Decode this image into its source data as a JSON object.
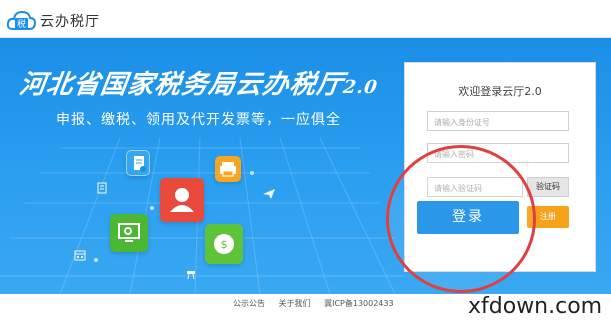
{
  "header": {
    "logo_icon_char": "税",
    "logo_text": "云办税厅"
  },
  "banner": {
    "title_main": "河北省国家税务局云办税厅",
    "title_version": "2.0",
    "subtitle": "申报、缴税、领用及代开发票等，一应俱全"
  },
  "login": {
    "title": "欢迎登录云厅2.0",
    "id_placeholder": "请输入身份证号",
    "password_placeholder": "请输入密码",
    "captcha_placeholder": "请输入验证码",
    "captcha_button": "验证码",
    "login_button": "登录",
    "register_button": "注册"
  },
  "footer": {
    "links": [
      "公示公告",
      "关于我们",
      "冀ICP备13002433"
    ]
  },
  "watermark": "xfdown.com",
  "colors": {
    "banner_blue": "#2b9ff0",
    "login_blue": "#1a8fe6",
    "register_orange": "#f7a21b",
    "highlight_red": "#e0403e",
    "user_tile_red": "#e84a3c",
    "green_tile": "#5cc33b",
    "orange_tile": "#f5a623"
  },
  "icons": [
    "cloud-tax-logo-icon",
    "document-icon",
    "user-icon",
    "printer-icon",
    "monitor-icon",
    "coin-icon",
    "calendar-icon",
    "paper-plane-icon",
    "list-icon"
  ]
}
